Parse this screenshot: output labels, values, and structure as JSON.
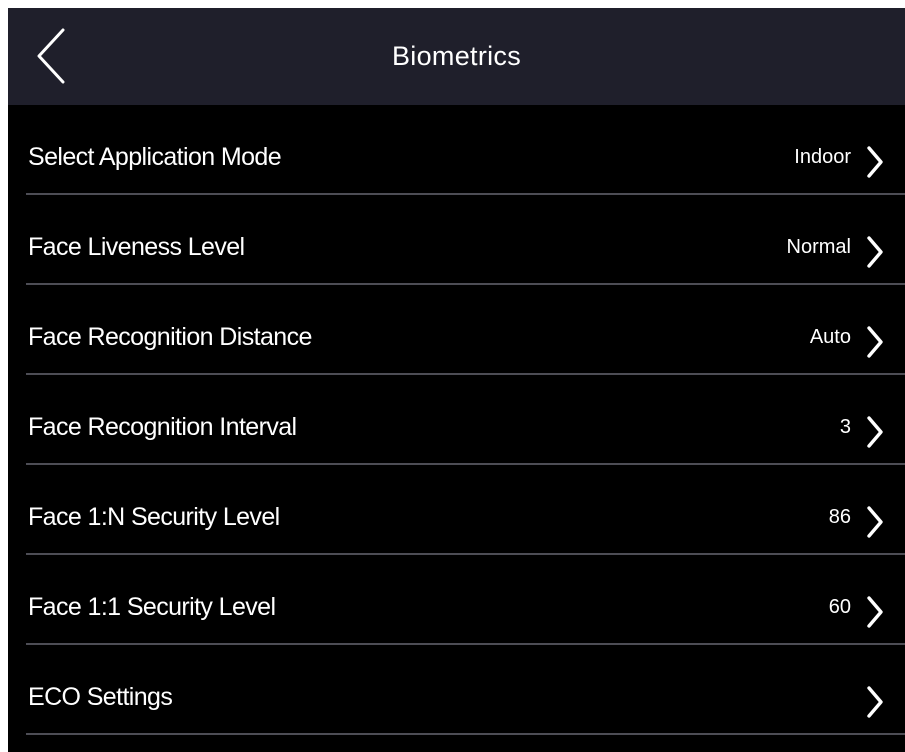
{
  "header": {
    "title": "Biometrics",
    "back_icon": "chevron-left-icon"
  },
  "settings": {
    "items": [
      {
        "label": "Select Application Mode",
        "value": "Indoor"
      },
      {
        "label": "Face Liveness Level",
        "value": "Normal"
      },
      {
        "label": "Face Recognition Distance",
        "value": "Auto"
      },
      {
        "label": "Face Recognition Interval",
        "value": "3"
      },
      {
        "label": "Face 1:N Security Level",
        "value": "86"
      },
      {
        "label": "Face 1:1 Security Level",
        "value": "60"
      },
      {
        "label": "ECO Settings",
        "value": ""
      }
    ]
  },
  "colors": {
    "background": "#000000",
    "header_background": "#1f1f2b",
    "text": "#ffffff",
    "divider": "#4d4d55"
  }
}
